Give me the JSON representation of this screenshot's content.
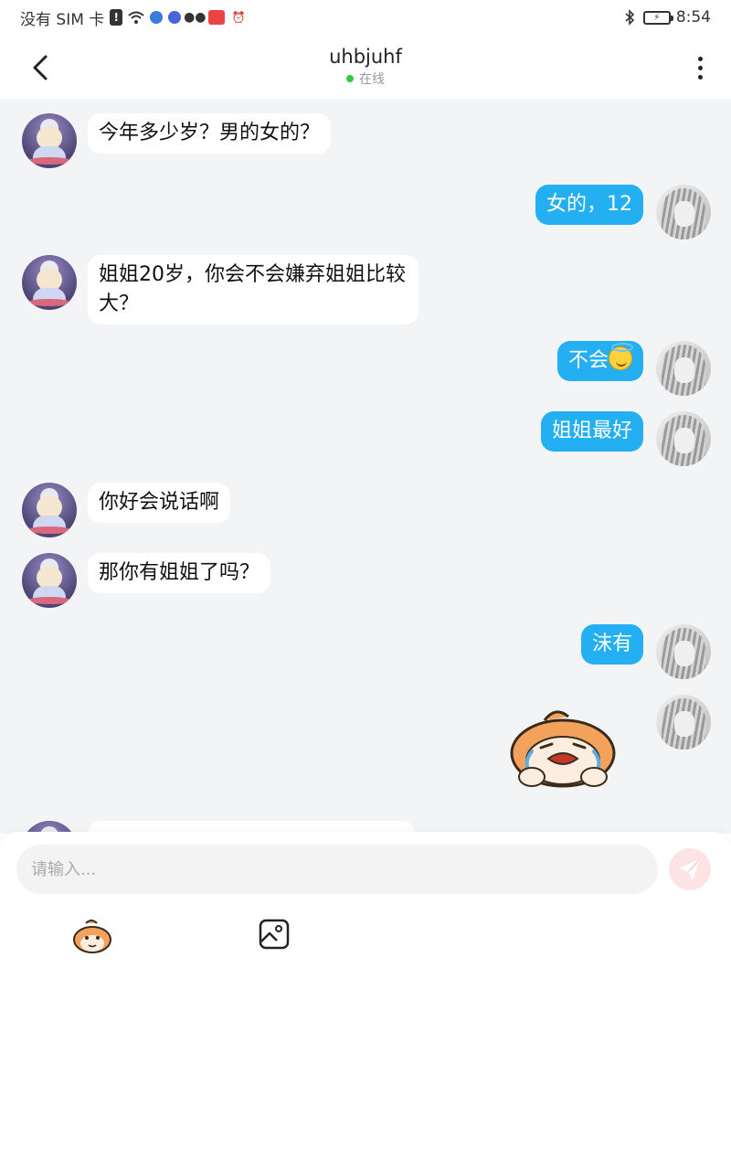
{
  "status_bar": {
    "carrier": "没有 SIM 卡",
    "time": "8:54"
  },
  "header": {
    "title": "uhbjuhf",
    "status": "在线"
  },
  "messages": [
    {
      "side": "left",
      "text": "今年多少岁？男的女的？"
    },
    {
      "side": "right",
      "text": "女的，12"
    },
    {
      "side": "left",
      "text": "姐姐20岁，你会不会嫌弃姐姐比较大？"
    },
    {
      "side": "right",
      "text": "不会",
      "emoji": "halo-smile-emoji"
    },
    {
      "side": "right",
      "text": "姐姐最好"
    },
    {
      "side": "left",
      "text": "你好会说话啊"
    },
    {
      "side": "left",
      "text": "那你有姐姐了吗？"
    },
    {
      "side": "right",
      "text": "沫有"
    },
    {
      "side": "right",
      "sticker": "crying-dog-sticker"
    }
  ],
  "composer": {
    "placeholder": "请输入..."
  },
  "colors": {
    "bubble_right": "#25aff3",
    "bubble_left": "#ffffff",
    "chat_bg": "#f3f4f6",
    "online": "#2ecc40",
    "send_bg": "#fde4e4"
  },
  "icons": {
    "back": "chevron-left-icon",
    "more": "more-vertical-icon",
    "send": "send-icon",
    "emoji": "emoji-sticker-icon",
    "image": "image-icon"
  }
}
